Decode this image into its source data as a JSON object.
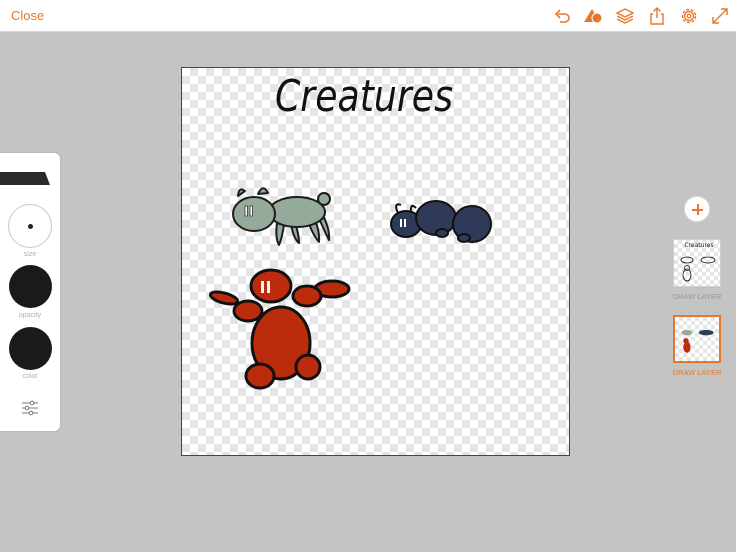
{
  "toolbar": {
    "close_label": "Close",
    "icons": [
      "undo-icon",
      "shape-icon",
      "layers-icon",
      "share-icon",
      "settings-icon",
      "fullscreen-icon"
    ]
  },
  "tool_panel": {
    "size_label": "size",
    "opacity_label": "opacity",
    "color_label": "color",
    "brush_color": "#1a1a1a"
  },
  "canvas": {
    "title_text": "Creatures",
    "creature_colors": [
      "#94ab9c",
      "#2e3a58",
      "#bb2c0c"
    ]
  },
  "layers": [
    {
      "label": "DRAW LAYER",
      "selected": false
    },
    {
      "label": "DRAW LAYER",
      "selected": true
    }
  ],
  "colors": {
    "accent": "#e8772e",
    "workspace": "#c4c4c4"
  }
}
